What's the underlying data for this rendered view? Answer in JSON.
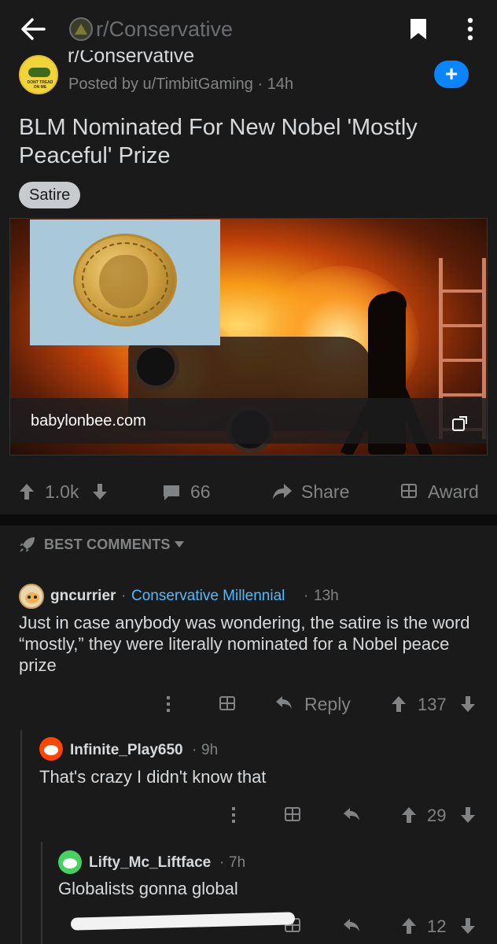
{
  "header": {
    "subreddit": "r/Conservative",
    "back_icon": "back-arrow-icon",
    "save_icon": "bookmark-icon",
    "more_icon": "more-vert-icon"
  },
  "post": {
    "subreddit_name": "r/Conservative",
    "posted_by": "Posted by u/TimbitGaming",
    "age": "14h",
    "title": "BLM Nominated For New Nobel 'Mostly Peaceful' Prize",
    "flair": "Satire",
    "link_domain": "babylonbee.com",
    "join_symbol": "+"
  },
  "actions": {
    "votes": "1.0k",
    "comments": "66",
    "share": "Share",
    "award": "Award"
  },
  "sort": {
    "label": "BEST COMMENTS"
  },
  "comments": [
    {
      "user": "gncurrier",
      "flair": "Conservative Millennial",
      "age": "13h",
      "text": "Just in case anybody was wondering, the satire is the word “mostly,” they were literally nominated for a Nobel peace prize",
      "reply": "Reply",
      "score": "137"
    },
    {
      "user": "Infinite_Play650",
      "age": "9h",
      "text": "That's crazy I didn't know that",
      "score": "29"
    },
    {
      "user": "Lifty_Mc_Liftface",
      "age": "7h",
      "text": "Globalists gonna global",
      "score": "12"
    }
  ],
  "colors": {
    "background": "#1a1a1b",
    "accent_blue": "#0a84ff",
    "flair_blue": "#4fbcff",
    "muted": "#818384"
  },
  "meta_separator": "·"
}
